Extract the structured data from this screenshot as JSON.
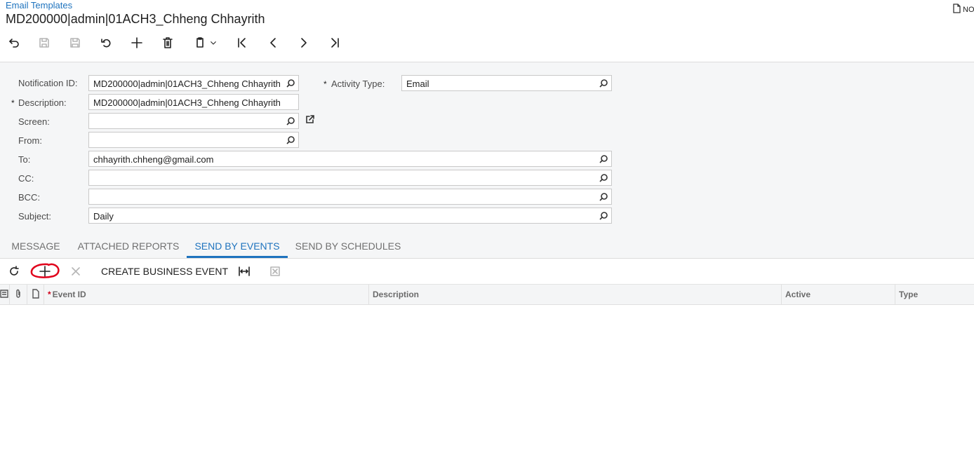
{
  "header": {
    "breadcrumb": "Email Templates",
    "title": "MD200000|admin|01ACH3_Chheng Chhayrith",
    "notes_label": "NO"
  },
  "toolbar": {
    "icons": [
      "back-icon",
      "save-close-icon",
      "save-icon",
      "cancel-icon",
      "add-icon",
      "delete-icon",
      "copy-paste-icon",
      "first-record-icon",
      "previous-record-icon",
      "next-record-icon",
      "last-record-icon"
    ],
    "disabled": [
      "save-close-icon",
      "save-icon"
    ]
  },
  "form": {
    "notification_id": {
      "label": "Notification ID:",
      "value": "MD200000|admin|01ACH3_Chheng Chhayrith"
    },
    "activity_type": {
      "label": "Activity Type:",
      "value": "Email",
      "required": "*"
    },
    "description": {
      "label": "Description:",
      "value": "MD200000|admin|01ACH3_Chheng Chhayrith",
      "required": "*"
    },
    "screen": {
      "label": "Screen:",
      "value": ""
    },
    "from": {
      "label": "From:",
      "value": ""
    },
    "to": {
      "label": "To:",
      "value": "chhayrith.chheng@gmail.com"
    },
    "cc": {
      "label": "CC:",
      "value": ""
    },
    "bcc": {
      "label": "BCC:",
      "value": ""
    },
    "subject": {
      "label": "Subject:",
      "value": "Daily"
    }
  },
  "tabs": [
    {
      "label": "MESSAGE",
      "active": false
    },
    {
      "label": "ATTACHED REPORTS",
      "active": false
    },
    {
      "label": "SEND BY EVENTS",
      "active": true
    },
    {
      "label": "SEND BY SCHEDULES",
      "active": false
    }
  ],
  "grid_toolbar": {
    "create_business_event": "CREATE BUSINESS EVENT"
  },
  "grid": {
    "columns": {
      "required": "*",
      "event_id": "Event ID",
      "description": "Description",
      "active": "Active",
      "type": "Type"
    },
    "rows": []
  },
  "colors": {
    "accent": "#1e73be",
    "annotation": "#e0001b",
    "form_background": "#f5f6f7"
  }
}
